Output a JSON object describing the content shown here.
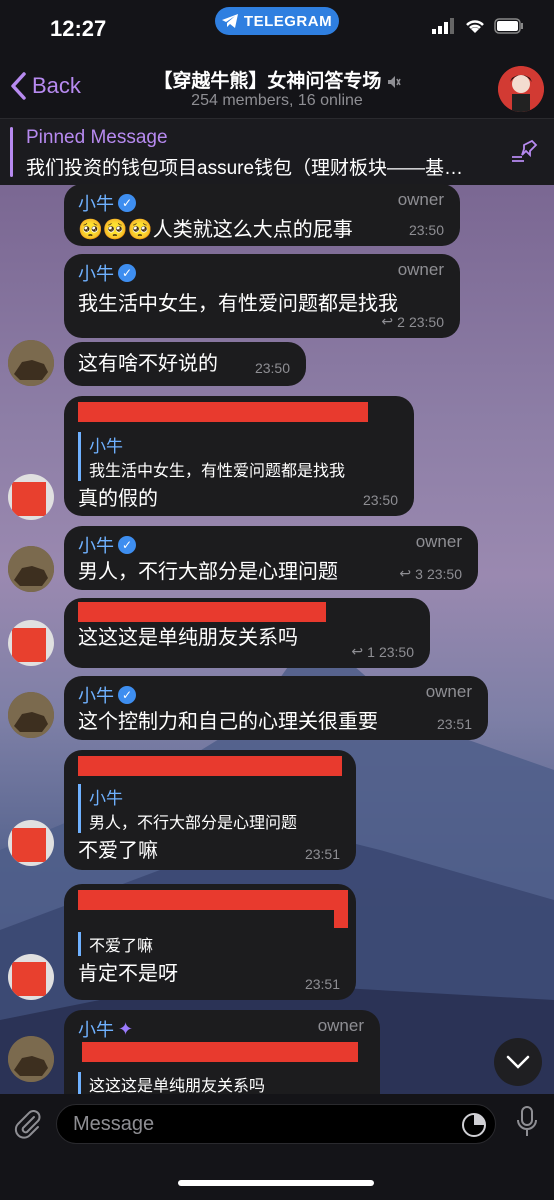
{
  "status": {
    "time": "12:27",
    "banner": "TELEGRAM"
  },
  "header": {
    "back": "Back",
    "title": "【穿越牛熊】女神问答专场",
    "subtitle": "254 members, 16 online",
    "mute_icon": "muted-speaker-icon"
  },
  "pinned": {
    "title": "Pinned Message",
    "text": "我们投资的钱包项目assure钱包（理财板块——基…"
  },
  "messages": [
    {
      "name": "小牛",
      "role": "owner",
      "text": "🥺🥺🥺人类就这么大点的屁事",
      "time": "23:50"
    },
    {
      "name": "小牛",
      "role": "owner",
      "text": "我生活中女生，有性爱问题都是找我",
      "replies": "2",
      "time": "23:50"
    },
    {
      "text": "这有啥不好说的",
      "time": "23:50"
    },
    {
      "quote_name": "小牛",
      "quote_text": "我生活中女生，有性爱问题都是找我",
      "text": "真的假的",
      "time": "23:50"
    },
    {
      "name": "小牛",
      "role": "owner",
      "text": "男人，不行大部分是心理问题",
      "replies": "3",
      "time": "23:50"
    },
    {
      "text": "这这这是单纯朋友关系吗",
      "replies": "1",
      "time": "23:50"
    },
    {
      "name": "小牛",
      "role": "owner",
      "text": "这个控制力和自己的心理关很重要",
      "time": "23:51"
    },
    {
      "quote_name": "小牛",
      "quote_text": "男人，不行大部分是心理问题",
      "text": "不爱了嘛",
      "time": "23:51"
    },
    {
      "quote_text": "不爱了嘛",
      "text": "肯定不是呀",
      "time": "23:51"
    },
    {
      "name": "小牛",
      "role": "owner",
      "quote_text": "这这这是单纯朋友关系吗"
    }
  ],
  "input": {
    "placeholder": "Message"
  }
}
